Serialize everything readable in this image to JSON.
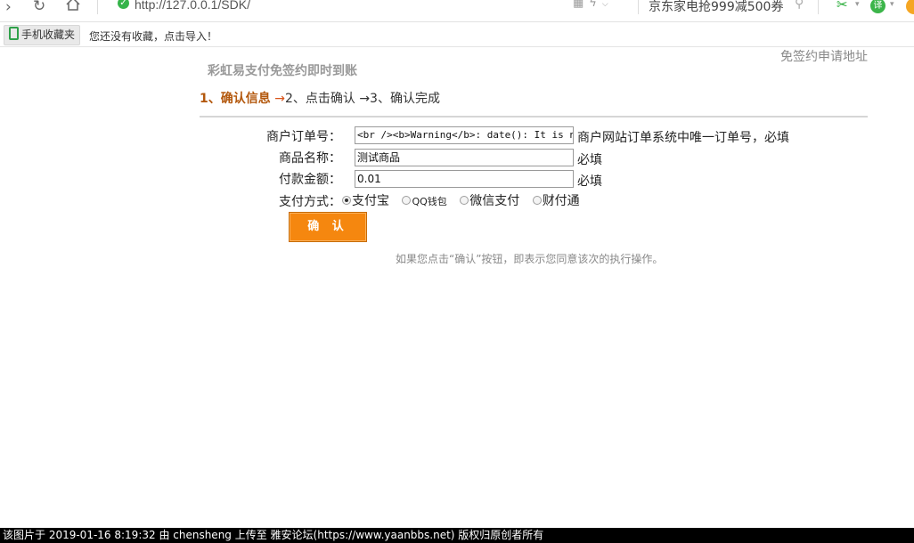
{
  "browser": {
    "url": "http://127.0.0.1/SDK/",
    "search_suggestion": "京东家电抢999减500券",
    "translate_label": "译"
  },
  "bookmarks": {
    "mobile_favorites_label": "手机收藏夹",
    "import_tip": "您还没有收藏，点击导入！"
  },
  "page": {
    "top_link": "免签约申请地址",
    "site_title": "彩虹易支付免签约即时到账",
    "steps": {
      "step1": "1、确认信息",
      "step2": "2、点击确认",
      "step3": "3、确认完成",
      "arrow": "→"
    },
    "form": {
      "order_no_label": "商户订单号：",
      "order_no_value": "<br /><b>Warning</b>:  date(): It is not safe",
      "order_no_note": "商户网站订单系统中唯一订单号，必填",
      "product_label": "商品名称：",
      "product_value": "测试商品",
      "product_note": "必填",
      "amount_label": "付款金额：",
      "amount_value": "0.01",
      "amount_note": "必填",
      "pay_method_label": "支付方式：",
      "pay_methods": [
        "支付宝",
        "QQ钱包",
        "微信支付",
        "财付通"
      ],
      "selected_pay_method": "支付宝"
    },
    "confirm_button": "确 认",
    "notice": "如果您点击“确认”按钮，即表示您同意该次的执行操作。"
  },
  "watermark": "该图片于 2019-01-16 8:19:32 由 chensheng 上传至 雅安论坛(https://www.yaanbbs.net) 版权归原创者所有",
  "colors": {
    "accent_orange": "#f5870f",
    "step_current": "#b3580d",
    "secure_green": "#35b44a"
  }
}
